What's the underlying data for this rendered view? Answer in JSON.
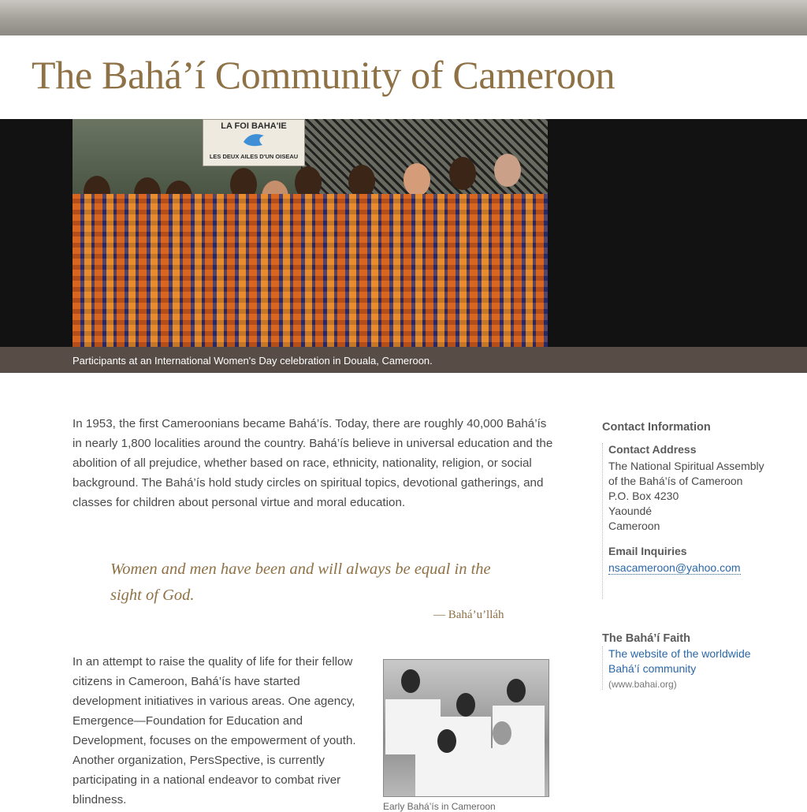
{
  "header": {
    "title": "The Bahá’í Community of Cameroon"
  },
  "hero": {
    "sign_text": "LA FOI BAHA'IE",
    "sign_subtext": "LES DEUX AILES D'UN OISEAU",
    "caption": "Participants at an International Women's Day celebration in Douala, Cameroon."
  },
  "main": {
    "intro": "In 1953, the first Cameroonians became Bahá’ís. Today, there are roughly 40,000 Bahá’ís in nearly 1,800 localities around the country. Bahá’ís believe in universal education and the abolition of all prejudice, whether based on race, ethnicity, nationality, religion, or social background. The Bahá’ís hold study circles on spiritual topics, devotional gatherings, and classes for children about personal virtue and moral education.",
    "quote": "Women and men have been and will always be equal in the sight of God.",
    "quote_attribution": "— Bahá’u’lláh",
    "body": "In an attempt to raise the quality of life for their fellow citizens in Cameroon, Bahá’ís have started development initiatives in various areas. One agency, Emergence—Foundation for Education and Development, focuses on the empowerment of youth. Another organization, PersSpective, is currently participating in a national endeavor to combat river blindness.",
    "photo2_caption": "Early Bahá’ís in Cameroon"
  },
  "sidebar": {
    "contact_heading": "Contact Information",
    "address_heading": "Contact Address",
    "address_lines": [
      "The National Spiritual Assembly",
      "of the Bahá’ís of Cameroon",
      "P.O. Box 4230",
      "Yaoundé",
      "Cameroon"
    ],
    "email_heading": "Email Inquiries",
    "email": "nsacameroon@yahoo.com",
    "faith_heading": "The Bahá’í Faith",
    "faith_link_line1": "The website of the worldwide",
    "faith_link_line2": "Bahá’í community",
    "faith_url": "(www.bahai.org)"
  },
  "colors": {
    "title": "#8e7145",
    "link": "#2a67a9",
    "caption_bar": "#574c46",
    "hero_bg": "#121212"
  }
}
